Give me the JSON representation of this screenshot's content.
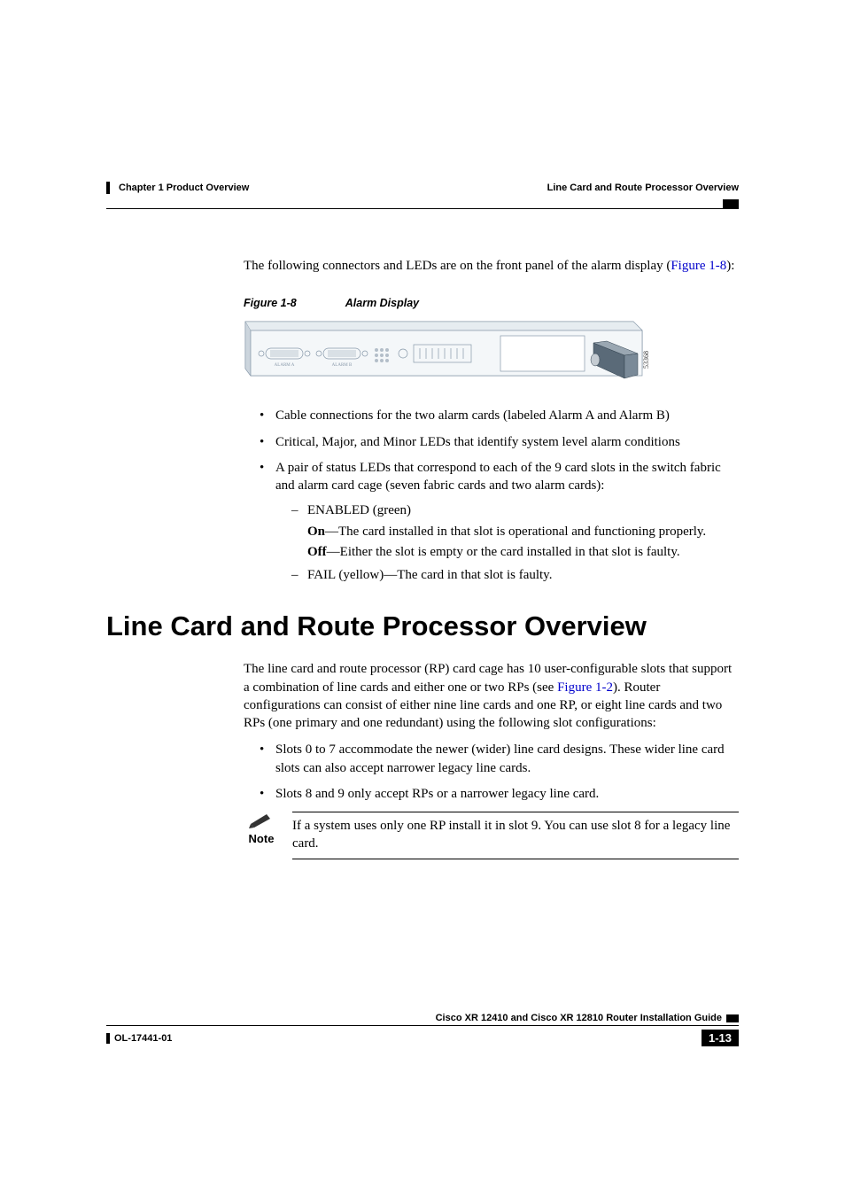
{
  "header": {
    "chapter": "Chapter 1    Product Overview",
    "section_right": "Line Card and Route Processor Overview"
  },
  "intro": {
    "text_before_link": "The following connectors and LEDs are on the front panel of the alarm display (",
    "link": "Figure 1-8",
    "text_after_link": "):"
  },
  "figure": {
    "label_num": "Figure 1-8",
    "label_title": "Alarm Display",
    "svg_label_a": "ALARM A",
    "svg_label_b": "ALARM B",
    "svg_id": "53368"
  },
  "bullets": {
    "item1": "Cable connections for the two alarm cards (labeled Alarm A and Alarm B)",
    "item2": "Critical, Major, and Minor LEDs that identify system level alarm conditions",
    "item3": "A pair of status LEDs that correspond to each of the 9 card slots in the switch fabric and alarm card cage (seven fabric cards and two alarm cards):",
    "sub1": {
      "title": "ENABLED (green)",
      "on_label": "On",
      "on_text": "—The card installed in that slot is operational and functioning properly.",
      "off_label": "Off",
      "off_text": "—Either the slot is empty or the card installed in that slot is faulty."
    },
    "sub2": "FAIL (yellow)—The card in that slot is faulty."
  },
  "heading": "Line Card and Route Processor Overview",
  "main": {
    "para1_before": "The line card and route processor (RP) card cage has 10 user-configurable slots that support a combination of line cards and either one or two RPs (see ",
    "para1_link": "Figure 1-2",
    "para1_after": "). Router configurations can consist of either nine line cards and one RP, or eight line cards and two RPs (one primary and one redundant) using the following slot configurations:",
    "bullet1": "Slots 0 to 7 accommodate the newer (wider) line card designs. These wider line card slots can also accept narrower legacy line cards.",
    "bullet2": "Slots 8 and 9 only accept RPs or a narrower legacy line card."
  },
  "note": {
    "label": "Note",
    "text": "If a system uses only one RP install it in slot 9. You can use slot 8 for a legacy line card."
  },
  "footer": {
    "guide_title": "Cisco XR 12410 and Cisco XR 12810 Router Installation Guide",
    "doc_id": "OL-17441-01",
    "page_num": "1-13"
  }
}
